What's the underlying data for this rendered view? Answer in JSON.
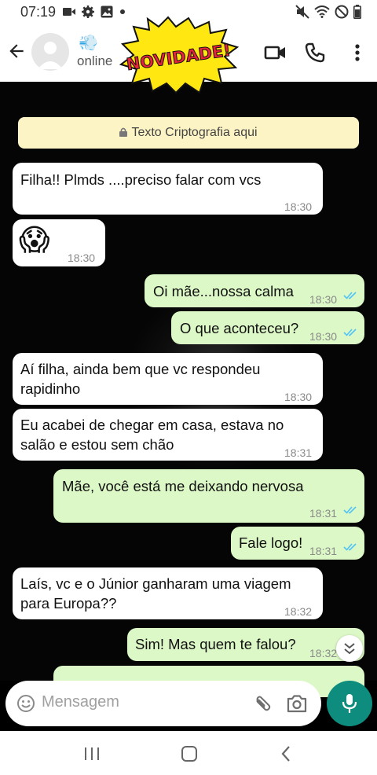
{
  "status_bar": {
    "time": "07:19",
    "icons": [
      "video-icon",
      "settings-icon",
      "image-icon",
      "dot",
      "mute-icon",
      "wifi-icon",
      "dnd-icon",
      "battery-icon"
    ]
  },
  "header": {
    "status": "online",
    "sticker_text": "NOVIDADE!",
    "icons": [
      "back-arrow-icon",
      "video-call-icon",
      "phone-icon",
      "more-vertical-icon"
    ],
    "accent": "#128c7e"
  },
  "banner": {
    "text": "Texto Criptografia aqui"
  },
  "messages": [
    {
      "dir": "in",
      "text": "Filha!! Plmds ....preciso falar com vcs",
      "time": "18:30"
    },
    {
      "dir": "in",
      "text": "😱",
      "time": "18:30"
    },
    {
      "dir": "out",
      "text": "Oi mãe...nossa calma",
      "time": "18:30"
    },
    {
      "dir": "out",
      "text": "O que aconteceu?",
      "time": "18:30"
    },
    {
      "dir": "in",
      "lines": [
        "Aí filha, ainda bem que vc respondeu",
        "rapidinho"
      ],
      "time": "18:30"
    },
    {
      "dir": "in",
      "lines": [
        "Eu acabei de chegar em casa,  estava no",
        "salão e estou sem chão"
      ],
      "time": "18:31"
    },
    {
      "dir": "out",
      "text": "Mãe,  você está me deixando nervosa",
      "time": "18:31"
    },
    {
      "dir": "out",
      "text": "Fale logo!",
      "time": "18:31"
    },
    {
      "dir": "in",
      "lines": [
        "Laís, vc e o Júnior ganharam uma viagem",
        "para Europa??"
      ],
      "time": "18:32"
    },
    {
      "dir": "out",
      "text": "Sim! Mas quem te falou?",
      "time": "18:32"
    }
  ],
  "input": {
    "placeholder": "Mensagem"
  },
  "colors": {
    "incoming_bubble": "#ffffff",
    "outgoing_bubble": "#dcf8c6",
    "read_ticks": "#4fc3f7",
    "banner": "#fdf4c5",
    "mic_button": "#0e8c7e"
  }
}
